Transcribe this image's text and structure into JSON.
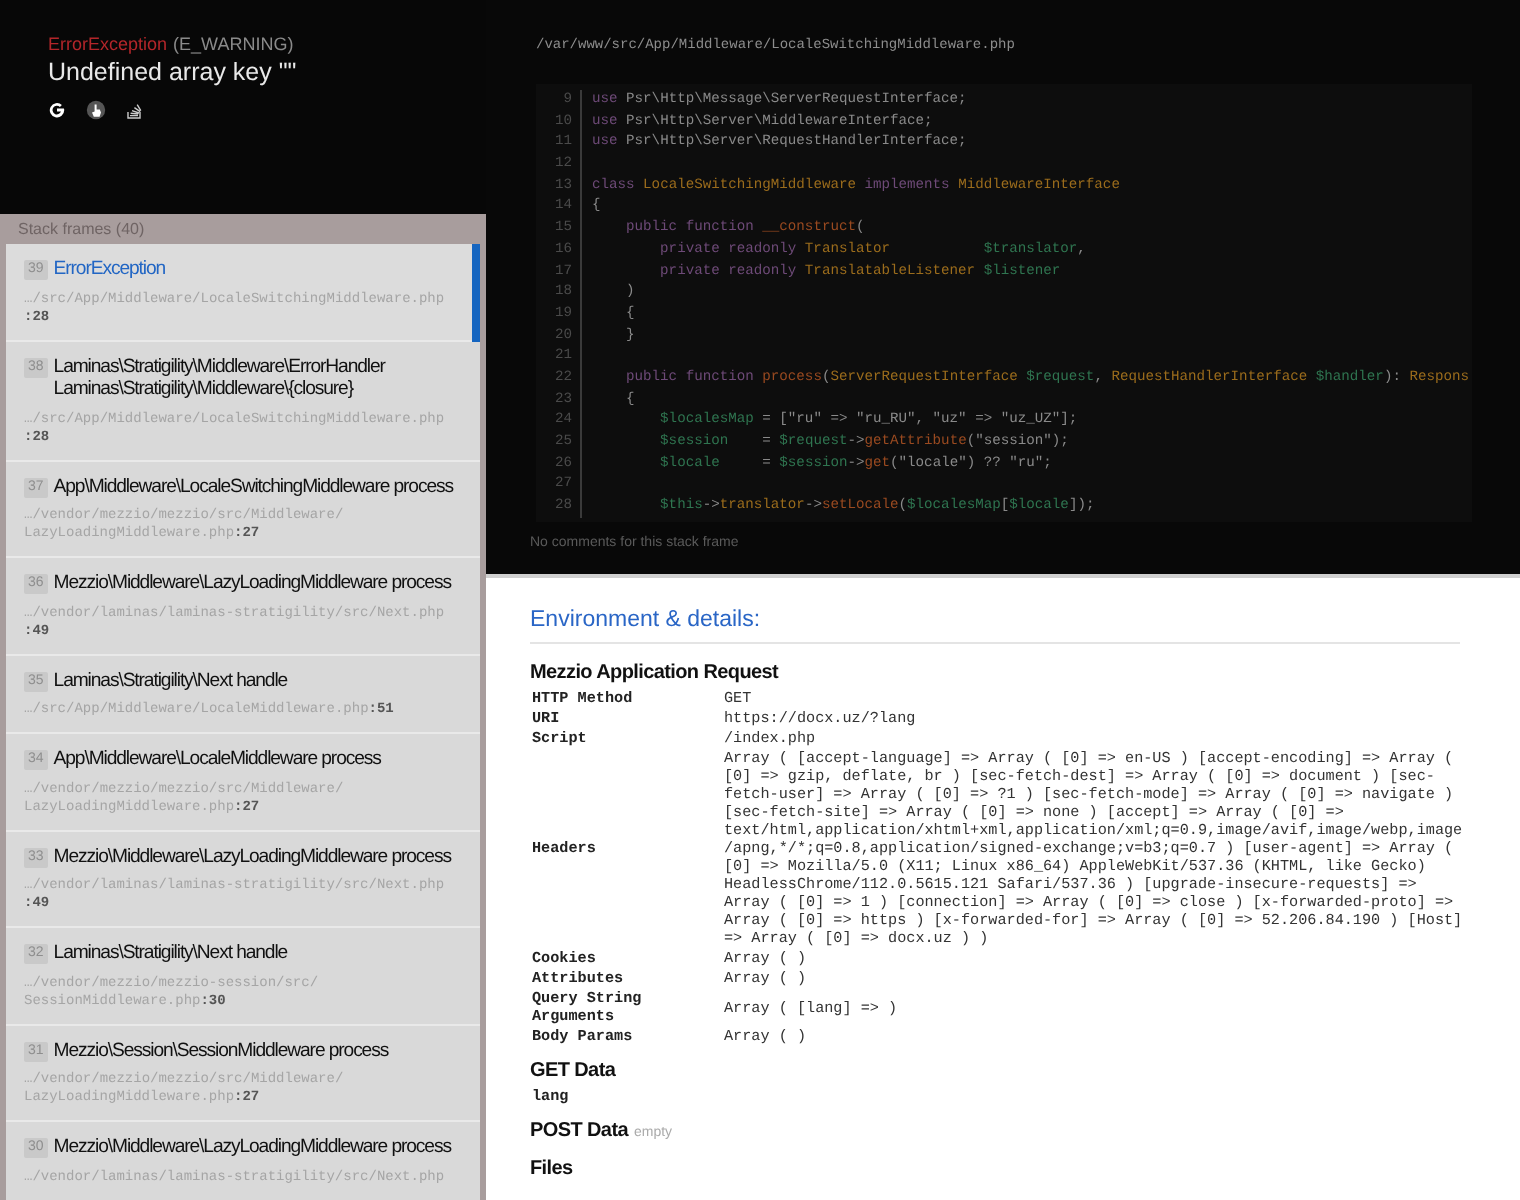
{
  "error": {
    "class": "ErrorException",
    "type": "(E_WARNING)",
    "message": "Undefined array key \"\""
  },
  "stack_frames": {
    "title": "Stack frames (40)",
    "frames": [
      {
        "index": "39",
        "title": "ErrorException",
        "file": "…/src/App/Middleware/LocaleSwitchingMiddleware.php",
        "line": ":28",
        "selected": true
      },
      {
        "index": "38",
        "title": "Laminas\\Stratigility\\Middleware\\ErrorHandler Laminas\\Stratigility\\Middleware\\{closure}",
        "file": "…/src/App/Middleware/LocaleSwitchingMiddleware.php",
        "line": ":28",
        "selected": false
      },
      {
        "index": "37",
        "title": "App\\Middleware\\LocaleSwitchingMiddleware process",
        "file": "…/vendor/mezzio/mezzio/src/Middleware/LazyLoadingMiddleware.php",
        "line": ":27",
        "selected": false
      },
      {
        "index": "36",
        "title": "Mezzio\\Middleware\\LazyLoadingMiddleware process",
        "file": "…/vendor/laminas/laminas-stratigility/src/Next.php",
        "line": ":49",
        "selected": false
      },
      {
        "index": "35",
        "title": "Laminas\\Stratigility\\Next handle",
        "file": "…/src/App/Middleware/LocaleMiddleware.php",
        "line": ":51",
        "selected": false
      },
      {
        "index": "34",
        "title": "App\\Middleware\\LocaleMiddleware process",
        "file": "…/vendor/mezzio/mezzio/src/Middleware/LazyLoadingMiddleware.php",
        "line": ":27",
        "selected": false
      },
      {
        "index": "33",
        "title": "Mezzio\\Middleware\\LazyLoadingMiddleware process",
        "file": "…/vendor/laminas/laminas-stratigility/src/Next.php",
        "line": ":49",
        "selected": false
      },
      {
        "index": "32",
        "title": "Laminas\\Stratigility\\Next handle",
        "file": "…/vendor/mezzio/mezzio-session/src/SessionMiddleware.php",
        "line": ":30",
        "selected": false
      },
      {
        "index": "31",
        "title": "Mezzio\\Session\\SessionMiddleware process",
        "file": "…/vendor/mezzio/mezzio/src/Middleware/LazyLoadingMiddleware.php",
        "line": ":27",
        "selected": false
      },
      {
        "index": "30",
        "title": "Mezzio\\Middleware\\LazyLoadingMiddleware process",
        "file": "…/vendor/laminas/laminas-stratigility/src/Next.php",
        "selected": false
      }
    ]
  },
  "code": {
    "path": "/var/www/src/App/Middleware/LocaleSwitchingMiddleware.php",
    "lines": [
      {
        "number": "9",
        "tokens": [
          {
            "kind": "keyword",
            "text": "use"
          },
          {
            "kind": "plain",
            "text": " Psr\\Http\\Message\\ServerRequestInterface;"
          }
        ]
      },
      {
        "number": "10",
        "tokens": [
          {
            "kind": "keyword",
            "text": "use"
          },
          {
            "kind": "plain",
            "text": " Psr\\Http\\Server\\MiddlewareInterface;"
          }
        ]
      },
      {
        "number": "11",
        "tokens": [
          {
            "kind": "keyword",
            "text": "use"
          },
          {
            "kind": "plain",
            "text": " Psr\\Http\\Server\\RequestHandlerInterface;"
          }
        ]
      },
      {
        "number": "12"
      },
      {
        "number": "13",
        "tokens": [
          {
            "kind": "keyword",
            "text": "class"
          },
          {
            "kind": "type",
            "text": " LocaleSwitchingMiddleware"
          },
          {
            "kind": "keyword",
            "text": " implements"
          },
          {
            "kind": "type",
            "text": " MiddlewareInterface"
          }
        ]
      },
      {
        "number": "14",
        "tokens": [
          {
            "kind": "plain",
            "text": "{"
          }
        ]
      },
      {
        "number": "15",
        "tokens": [
          {
            "kind": "keyword",
            "text": "    public function"
          },
          {
            "kind": "func",
            "text": " __construct"
          },
          {
            "kind": "plain",
            "text": "("
          }
        ]
      },
      {
        "number": "16",
        "tokens": [
          {
            "kind": "keyword",
            "text": "        private readonly"
          },
          {
            "kind": "type",
            "text": " Translator"
          },
          {
            "kind": "var",
            "text": "           $translator"
          },
          {
            "kind": "plain",
            "text": ","
          }
        ]
      },
      {
        "number": "17",
        "tokens": [
          {
            "kind": "keyword",
            "text": "        private readonly"
          },
          {
            "kind": "type",
            "text": " TranslatableListener"
          },
          {
            "kind": "var",
            "text": " $listener"
          }
        ]
      },
      {
        "number": "18",
        "tokens": [
          {
            "kind": "plain",
            "text": "    )"
          }
        ]
      },
      {
        "number": "19",
        "tokens": [
          {
            "kind": "plain",
            "text": "    {"
          }
        ]
      },
      {
        "number": "20",
        "tokens": [
          {
            "kind": "plain",
            "text": "    }"
          }
        ]
      },
      {
        "number": "21"
      },
      {
        "number": "22",
        "tokens": [
          {
            "kind": "keyword",
            "text": "    public function"
          },
          {
            "kind": "func",
            "text": " process"
          },
          {
            "kind": "plain",
            "text": "("
          },
          {
            "kind": "type",
            "text": "ServerRequestInterface"
          },
          {
            "kind": "var",
            "text": " $request"
          },
          {
            "kind": "plain",
            "text": ", "
          },
          {
            "kind": "type",
            "text": "RequestHandlerInterface"
          },
          {
            "kind": "var",
            "text": " $handler"
          },
          {
            "kind": "plain",
            "text": "): "
          },
          {
            "kind": "type",
            "text": "Respons"
          }
        ]
      },
      {
        "number": "23",
        "tokens": [
          {
            "kind": "plain",
            "text": "    {"
          }
        ]
      },
      {
        "number": "24",
        "tokens": [
          {
            "kind": "var",
            "text": "        $localesMap"
          },
          {
            "kind": "plain",
            "text": " = [\"ru\" => \"ru_RU\", \"uz\" => \"uz_UZ\"];"
          }
        ]
      },
      {
        "number": "25",
        "tokens": [
          {
            "kind": "var",
            "text": "        $session"
          },
          {
            "kind": "plain",
            "text": "    = "
          },
          {
            "kind": "var",
            "text": "$request"
          },
          {
            "kind": "plain",
            "text": "->"
          },
          {
            "kind": "func",
            "text": "getAttribute"
          },
          {
            "kind": "plain",
            "text": "(\"session\");"
          }
        ]
      },
      {
        "number": "26",
        "tokens": [
          {
            "kind": "var",
            "text": "        $locale"
          },
          {
            "kind": "plain",
            "text": "     = "
          },
          {
            "kind": "var",
            "text": "$session"
          },
          {
            "kind": "plain",
            "text": "->"
          },
          {
            "kind": "func",
            "text": "get"
          },
          {
            "kind": "plain",
            "text": "(\"locale\") ?? \"ru\";"
          }
        ]
      },
      {
        "number": "27"
      },
      {
        "number": "28",
        "tokens": [
          {
            "kind": "var",
            "text": "        $this"
          },
          {
            "kind": "plain",
            "text": "->"
          },
          {
            "kind": "type",
            "text": "translator"
          },
          {
            "kind": "plain",
            "text": "->"
          },
          {
            "kind": "func",
            "text": "setLocale"
          },
          {
            "kind": "plain",
            "text": "("
          },
          {
            "kind": "var",
            "text": "$localesMap"
          },
          {
            "kind": "plain",
            "text": "["
          },
          {
            "kind": "var",
            "text": "$locale"
          },
          {
            "kind": "plain",
            "text": "]);"
          }
        ]
      }
    ],
    "comment": "No comments for this stack frame"
  },
  "details": {
    "title": "Environment & details:",
    "sections": [
      {
        "title": "Mezzio Application Request",
        "rows": [
          {
            "key": "HTTP Method",
            "value": "GET"
          },
          {
            "key": "URI",
            "value": "https://docx.uz/?lang"
          },
          {
            "key": "Script",
            "value": "/index.php"
          },
          {
            "key": "Headers",
            "value": "Array ( [accept-language] => Array ( [0] => en-US ) [accept-encoding] => Array ( [0] => gzip, deflate, br ) [sec-fetch-dest] => Array ( [0] => document ) [sec-fetch-user] => Array ( [0] => ?1 ) [sec-fetch-mode] => Array ( [0] => navigate ) [sec-fetch-site] => Array ( [0] => none ) [accept] => Array ( [0] => text/html,application/xhtml+xml,application/xml;q=0.9,image/avif,image/webp,image/apng,*/*;q=0.8,application/signed-exchange;v=b3;q=0.7 ) [user-agent] => Array ( [0] => Mozilla/5.0 (X11; Linux x86_64) AppleWebKit/537.36 (KHTML, like Gecko) HeadlessChrome/112.0.5615.121 Safari/537.36 ) [upgrade-insecure-requests] => Array ( [0] => 1 ) [connection] => Array ( [0] => close ) [x-forwarded-proto] => Array ( [0] => https ) [x-forwarded-for] => Array ( [0] => 52.206.84.190 ) [Host] => Array ( [0] => docx.uz ) )"
          },
          {
            "key": "Cookies",
            "value": "Array ( )"
          },
          {
            "key": "Attributes",
            "value": "Array ( )"
          },
          {
            "key": "Query String Arguments",
            "value": "Array ( [lang] => )"
          },
          {
            "key": "Body Params",
            "value": "Array ( )"
          }
        ]
      },
      {
        "title": "GET Data",
        "rows": [
          {
            "key": "lang"
          }
        ]
      },
      {
        "title": "POST Data",
        "note": "empty"
      },
      {
        "title": "Files"
      }
    ]
  }
}
